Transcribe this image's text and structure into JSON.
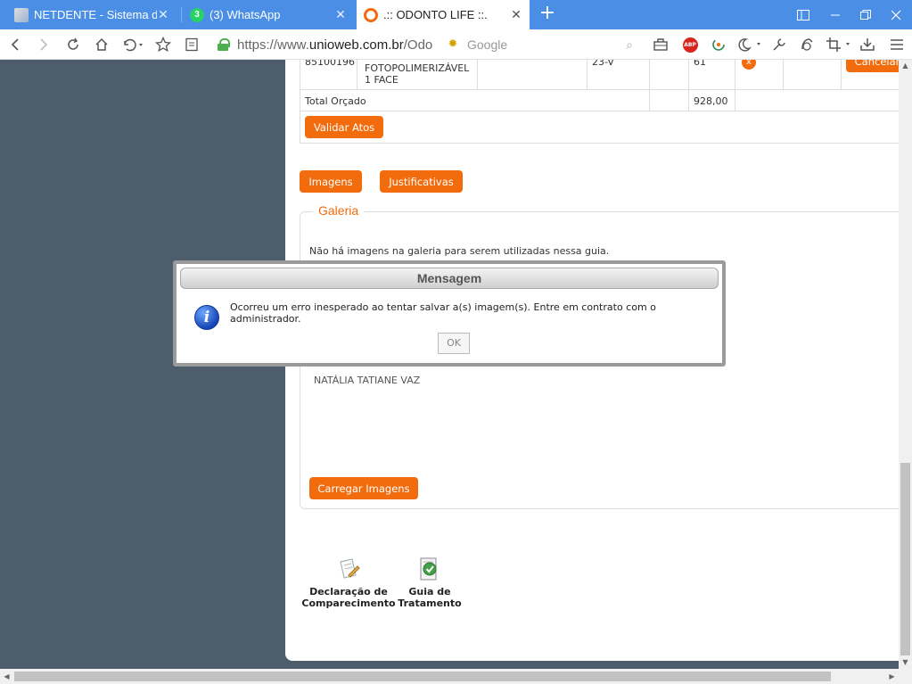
{
  "browser": {
    "tabs": [
      {
        "title": "NETDENTE - Sistema de",
        "close": "✕"
      },
      {
        "title": "(3) WhatsApp",
        "badge": "3",
        "close": "✕"
      },
      {
        "title": ".:: ODONTO LIFE ::.",
        "close": "✕"
      }
    ],
    "new_tab": "+",
    "url": {
      "prefix": "https://www.",
      "host": "unioweb.com.br",
      "path": "/Odo"
    },
    "search_placeholder": "Google"
  },
  "table": {
    "row": {
      "code": "85100196",
      "description_lines": [
        "FOTOPOLIMERIZÁVEL",
        "1 FACE"
      ],
      "tooth": "23-V",
      "value": "61",
      "remove_icon": "x",
      "cancel_label": "Cancelar"
    },
    "total_label": "Total Orçado",
    "total_value": "928,00"
  },
  "buttons": {
    "validate": "Validar Atos",
    "images": "Imagens",
    "justifications": "Justificativas",
    "upload_images": "Carregar Imagens"
  },
  "gallery": {
    "legend": "Galeria",
    "empty_message": "Não há imagens na galeria para serem utilizadas nessa guia.",
    "patient_name": "NATÁLIA TATIANE VAZ"
  },
  "footer_links": [
    {
      "label_lines": [
        "Declaração de",
        "Comparecimento"
      ],
      "icon": "document-pencil-icon"
    },
    {
      "label_lines": [
        "Guia de",
        "Tratamento"
      ],
      "icon": "document-check-icon"
    }
  ],
  "dialog": {
    "title": "Mensagem",
    "message": "Ocorreu um erro inesperado ao tentar salvar a(s) imagem(s). Entre em contrato com o administrador.",
    "icon": "i",
    "ok_label": "OK"
  },
  "colors": {
    "accent": "#f26c0d",
    "tabbar": "#4a8ee6",
    "page_background": "#4e5d6c"
  }
}
